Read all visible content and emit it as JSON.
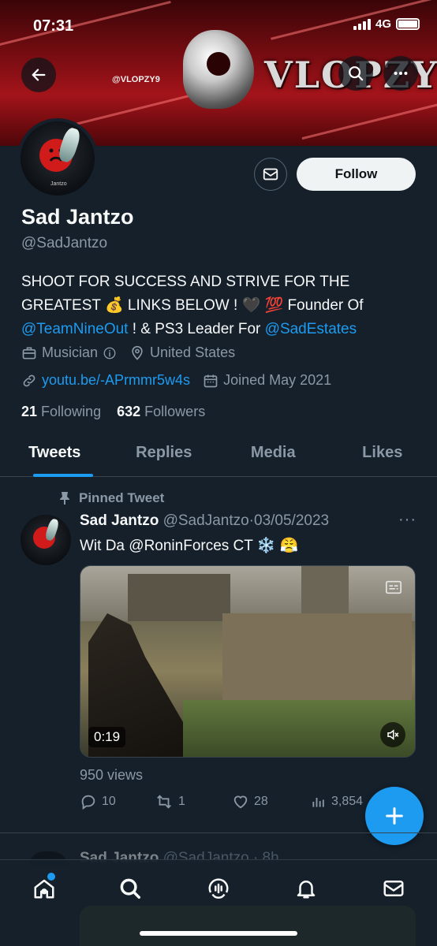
{
  "status_bar": {
    "time": "07:31",
    "network": "4G"
  },
  "banner": {
    "title": "VLOPZY",
    "handle": "@VLOPZY9"
  },
  "profile": {
    "name": "Sad Jantzo",
    "handle": "@SadJantzo",
    "avatar_text": "Jantzo",
    "follow_label": "Follow",
    "bio_line1": "SHOOT FOR SUCCESS AND STRIVE FOR THE",
    "bio_line2a": "GREATEST ",
    "bio_emoji1": "💰",
    "bio_line2b": " LINKS BELOW ! ",
    "bio_emoji2": "🖤",
    "bio_emoji3": "💯",
    "bio_line2c": " Founder Of",
    "bio_mention1": "@TeamNineOut",
    "bio_line3": " ! & PS3 Leader For ",
    "bio_mention2": "@SadEstates",
    "category": "Musician",
    "location": "United States",
    "website": "youtu.be/-APrmmr5w4s",
    "joined": "Joined May 2021",
    "following_count": "21",
    "following_label": "Following",
    "followers_count": "632",
    "followers_label": "Followers"
  },
  "tabs": [
    {
      "label": "Tweets",
      "active": true
    },
    {
      "label": "Replies"
    },
    {
      "label": "Media"
    },
    {
      "label": "Likes"
    }
  ],
  "pinned_tweet": {
    "pinned_label": "Pinned Tweet",
    "author": "Sad Jantzo",
    "handle": "@SadJantzo",
    "separator": "·",
    "date": "03/05/2023",
    "more": "···",
    "text": "Wit Da @RoninForces CT ",
    "emoji1": "❄️",
    "emoji2": "😤",
    "video_duration": "0:19",
    "views": "950 views",
    "replies": "10",
    "retweets": "1",
    "likes": "28",
    "view_count": "3,854"
  },
  "next_tweet": {
    "author": "Sad Jantzo",
    "handle": "@SadJantzo",
    "time": "· 8h"
  },
  "colors": {
    "accent": "#1d9bf0",
    "background": "#15202b",
    "muted": "#8b98a5"
  }
}
